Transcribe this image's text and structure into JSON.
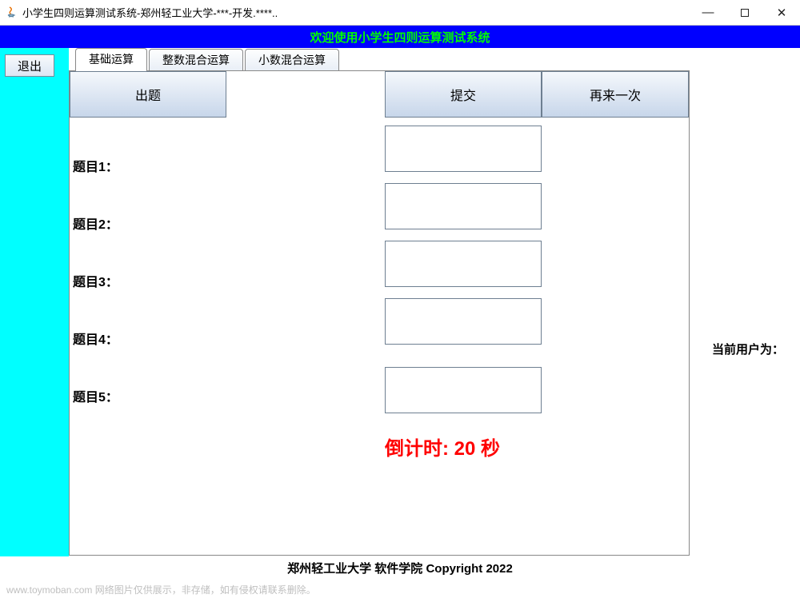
{
  "window": {
    "title": "小学生四则运算测试系统-郑州轻工业大学-***-开发.****..",
    "minimize": "—",
    "maximize": "□",
    "close": "✕"
  },
  "banner": "欢迎使用小学生四则运算测试系统",
  "sidebar": {
    "exit_label": "退出"
  },
  "tabs": [
    {
      "label": "基础运算",
      "active": true
    },
    {
      "label": "整数混合运算",
      "active": false
    },
    {
      "label": "小数混合运算",
      "active": false
    }
  ],
  "buttons": {
    "generate": "出题",
    "submit": "提交",
    "again": "再来一次"
  },
  "questions": [
    {
      "label": "题目1：",
      "answer": ""
    },
    {
      "label": "题目2：",
      "answer": ""
    },
    {
      "label": "题目3：",
      "answer": ""
    },
    {
      "label": "题目4：",
      "answer": ""
    },
    {
      "label": "题目5：",
      "answer": ""
    }
  ],
  "countdown": {
    "prefix": "倒计时:  ",
    "value": "20",
    "suffix": " 秒"
  },
  "current_user_label": "当前用户为：",
  "footer": "郑州轻工业大学   软件学院  Copyright 2022",
  "watermark": "www.toymoban.com  网络图片仅供展示，非存储，如有侵权请联系删除。"
}
